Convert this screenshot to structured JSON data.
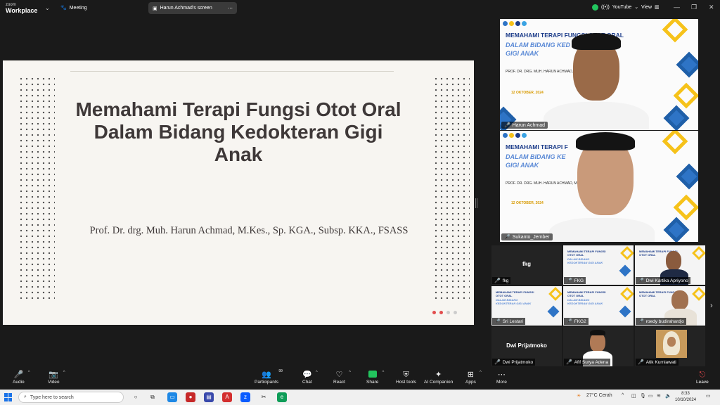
{
  "topbar": {
    "brand_line1": "zoom",
    "brand_line2": "Workplace",
    "meeting_label": "Meeting",
    "share_label": "Harun Achmad's screen",
    "youtube_label": "YouTube",
    "view_label": "View"
  },
  "slide": {
    "title": "Memahami Terapi Fungsi Otot Oral Dalam Bidang Kedokteran Gigi Anak",
    "author": "Prof. Dr. drg. Muh. Harun Achmad, M.Kes., Sp. KGA., Subsp. KKA., FSASS"
  },
  "speakers": [
    {
      "name": "Harun Achmad",
      "slide_title": "MEMAHAMI TERAPI FUNGSI OTOT ORAL",
      "slide_subtitle": "DALAM BIDANG KED",
      "slide_subtitle2": "GIGI ANAK",
      "slide_meta": "PROF. DR. DRG. MUH. HARUN ACHMAD, M.",
      "slide_date": "12 OKTOBER, 2024"
    },
    {
      "name": "Sukanto_Jember",
      "slide_title": "MEMAHAMI TERAPI F",
      "slide_subtitle": "DALAM BIDANG KE",
      "slide_subtitle2": "GIGI ANAK",
      "slide_meta": "PROF. DR. DRG. MUH. HARUN ACHMAD, M.",
      "slide_date": "12 OKTOBER, 2024"
    }
  ],
  "gallery": [
    {
      "name": "fkg",
      "display": "fkg",
      "type": "text"
    },
    {
      "name": "FKG",
      "type": "slide"
    },
    {
      "name": "Dwi Kartika Apriyono",
      "type": "person"
    },
    {
      "name": "Sri Lestari",
      "type": "slide"
    },
    {
      "name": "FKG2",
      "type": "slide"
    },
    {
      "name": "roedy budirahardjo",
      "type": "person"
    },
    {
      "name": "Dwi Prijatmoko",
      "display": "Dwi Prijatmoko",
      "type": "text"
    },
    {
      "name": "Afif Surya Adena",
      "type": "person"
    },
    {
      "name": "Atik Kurniawati",
      "type": "person"
    }
  ],
  "mini_slide": {
    "title": "MEMAHAMI TERAPI FUNGSI OTOT ORAL",
    "subtitle": "DALAM BIDANG KEDOKTERAN GIGI ANAK"
  },
  "toolbar": {
    "audio": "Audio",
    "video": "Video",
    "participants": "Participants",
    "participants_count": "99",
    "chat": "Chat",
    "react": "React",
    "share": "Share",
    "host_tools": "Host tools",
    "ai_companion": "AI Companion",
    "apps": "Apps",
    "more": "More",
    "leave": "Leave"
  },
  "taskbar": {
    "search_placeholder": "Type here to search",
    "weather": "27°C Cerah",
    "time": "8:33",
    "date": "10/10/2024"
  },
  "colors": {
    "slide_title": "#3e3838",
    "brand_blue": "#1d3d8a",
    "accent_yellow": "#f6c21a",
    "leave_red": "#e5484d",
    "share_green": "#22c55e"
  }
}
